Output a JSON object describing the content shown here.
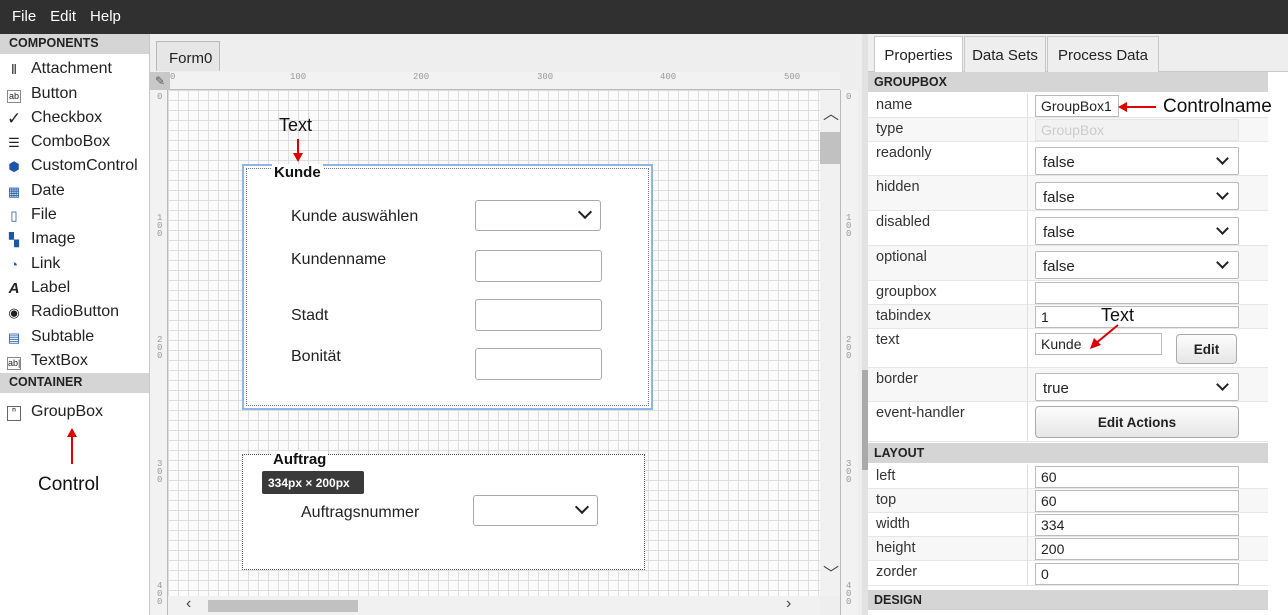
{
  "menu": {
    "file": "File",
    "edit": "Edit",
    "help": "Help"
  },
  "palette": {
    "components_header": "COMPONENTS",
    "items": [
      {
        "label": "Attachment",
        "icon": "attachment-icon"
      },
      {
        "label": "Button",
        "icon": "button-icon"
      },
      {
        "label": "Checkbox",
        "icon": "checkbox-icon"
      },
      {
        "label": "ComboBox",
        "icon": "combobox-icon"
      },
      {
        "label": "CustomControl",
        "icon": "customcontrol-icon"
      },
      {
        "label": "Date",
        "icon": "date-icon"
      },
      {
        "label": "File",
        "icon": "file-icon"
      },
      {
        "label": "Image",
        "icon": "image-icon"
      },
      {
        "label": "Link",
        "icon": "link-icon"
      },
      {
        "label": "Label",
        "icon": "label-icon"
      },
      {
        "label": "RadioButton",
        "icon": "radiobutton-icon"
      },
      {
        "label": "Subtable",
        "icon": "subtable-icon"
      },
      {
        "label": "TextBox",
        "icon": "textbox-icon"
      }
    ],
    "container_header": "CONTAINER",
    "container_items": [
      {
        "label": "GroupBox",
        "icon": "groupbox-icon"
      }
    ]
  },
  "canvas": {
    "form_tab": "Form0",
    "ruler_top": [
      "0",
      "100",
      "200",
      "300",
      "400",
      "500"
    ],
    "ruler_side": [
      "0",
      "100",
      "200",
      "300",
      "400"
    ],
    "size_tag": "334px × 200px",
    "groupbox1": {
      "legend": "Kunde",
      "fields": [
        {
          "label": "Kunde auswählen",
          "control": "select"
        },
        {
          "label": "Kundenname",
          "control": "text"
        },
        {
          "label": "Stadt",
          "control": "text"
        },
        {
          "label": "Bonität",
          "control": "text"
        }
      ]
    },
    "groupbox2": {
      "legend": "Auftrag",
      "fields": [
        {
          "label": "Auftragsnummer",
          "control": "select"
        }
      ]
    }
  },
  "properties": {
    "tabs": [
      "Properties",
      "Data Sets",
      "Process Data"
    ],
    "active_tab": "Properties",
    "groupbox_header": "GROUPBOX",
    "name": {
      "key": "name",
      "value": "GroupBox1"
    },
    "type": {
      "key": "type",
      "value": "GroupBox"
    },
    "readonly": {
      "key": "readonly",
      "value": "false"
    },
    "hidden": {
      "key": "hidden",
      "value": "false"
    },
    "disabled": {
      "key": "disabled",
      "value": "false"
    },
    "optional": {
      "key": "optional",
      "value": "false"
    },
    "groupbox": {
      "key": "groupbox",
      "value": ""
    },
    "tabindex": {
      "key": "tabindex",
      "value": "1"
    },
    "text": {
      "key": "text",
      "value": "Kunde",
      "button": "Edit"
    },
    "border": {
      "key": "border",
      "value": "true"
    },
    "event_handler": {
      "key": "event-handler",
      "button": "Edit Actions"
    },
    "layout_header": "LAYOUT",
    "left": {
      "key": "left",
      "value": "60"
    },
    "top": {
      "key": "top",
      "value": "60"
    },
    "width": {
      "key": "width",
      "value": "334"
    },
    "height": {
      "key": "height",
      "value": "200"
    },
    "zorder": {
      "key": "zorder",
      "value": "0"
    },
    "design_header": "DESIGN"
  },
  "annotations": {
    "text_canvas": "Text",
    "text_props": "Text",
    "controlname": "Controlname",
    "control": "Control",
    "color": "#e00000"
  }
}
